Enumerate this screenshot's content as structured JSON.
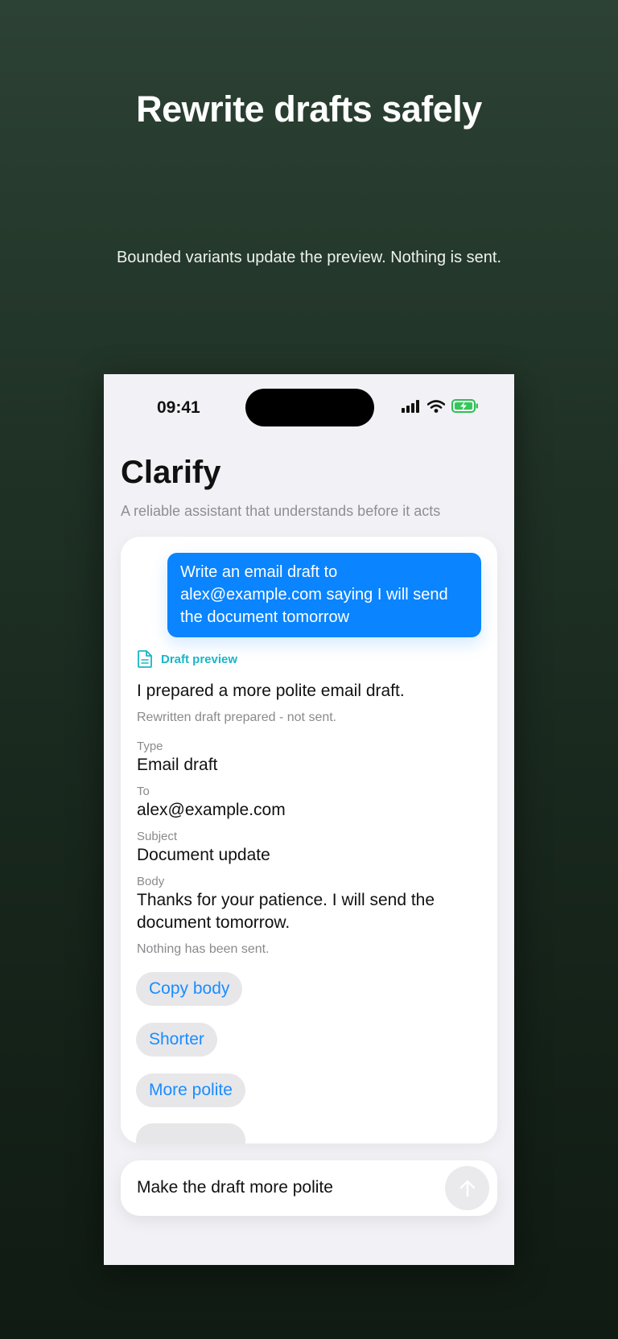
{
  "marketing": {
    "headline": "Rewrite drafts safely",
    "subline": "Bounded variants update the preview. Nothing is sent."
  },
  "status_bar": {
    "time": "09:41",
    "icons": [
      "cellular-signal-icon",
      "wifi-icon",
      "battery-charging-icon"
    ]
  },
  "app": {
    "title": "Clarify",
    "subtitle": "A reliable assistant that understands before it acts"
  },
  "conversation": {
    "user_message": "Write an email draft to alex@example.com saying I will send the document tomorrow",
    "preview_label": "Draft preview",
    "response_title": "I prepared a more polite email draft.",
    "response_status": "Rewritten draft prepared - not sent.",
    "fields": {
      "type_label": "Type",
      "type_value": "Email draft",
      "to_label": "To",
      "to_value": "alex@example.com",
      "subject_label": "Subject",
      "subject_value": "Document update",
      "body_label": "Body",
      "body_value": "Thanks for your patience. I will send the document tomorrow."
    },
    "note": "Nothing has been sent.",
    "actions": [
      "Copy body",
      "Shorter",
      "More polite"
    ]
  },
  "composer": {
    "value": "Make the draft more polite",
    "send_icon": "arrow-up-icon"
  },
  "colors": {
    "accent": "#0a84ff",
    "preview_accent": "#1ab5c9",
    "background_top": "#2c4234",
    "background_bottom": "#101b13"
  }
}
